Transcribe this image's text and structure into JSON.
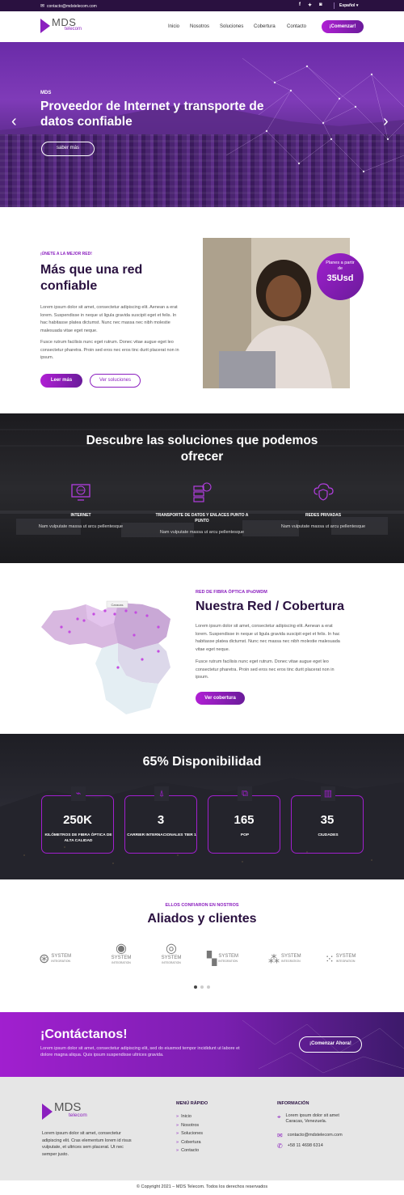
{
  "topbar": {
    "email": "contacto@mdstelecom.com",
    "social": [
      "f",
      "t",
      "ig"
    ],
    "language": "Español"
  },
  "header": {
    "logo_main": "MDS",
    "logo_sub": "telecom",
    "nav": [
      "Inicio",
      "Nosotros",
      "Soluciones",
      "Cobertura",
      "Contacto"
    ],
    "cta": "¡Comenzar!"
  },
  "hero": {
    "kicker": "MDS",
    "title": "Proveedor de Internet y transporte de datos confiable",
    "button": "saber más"
  },
  "intro": {
    "kicker": "¡ÚNETE A LA MEJOR RED!",
    "title": "Más que una red confiable",
    "p1": "Lorem ipsum dolor sit amet, consectetur adipiscing elit. Aenean a erat lorem. Suspendisse in neque ut ligula gravida suscipit eget et felis. In hac habitasse platea dictumst. Nunc nec massa nec nibh molestie malesuada vitae eget neque.",
    "p2": "Fusce rutrum facilisis nunc eget rutrum. Donec vitae augue eget leo consectetur pharetra. Proin sed eros nec eros tinc durit placerat non in ipsum.",
    "btn_primary": "Leer más",
    "btn_secondary": "Ver soluciones",
    "badge_top": "Planes a partir de",
    "badge_price": "35Usd"
  },
  "solutions": {
    "title": "Descubre las soluciones que podemos ofrecer",
    "items": [
      {
        "title": "INTERNET",
        "desc": "Nam vulputate massa ut arcu pellentesque"
      },
      {
        "title": "TRANSPORTE DE DATOS Y ENLACES PUNTO A PUNTO",
        "desc": "Nam vulputate massa ut arcu pellentesque"
      },
      {
        "title": "REDES PRIVADAS",
        "desc": "Nam vulputate massa ut arcu pellentesque"
      }
    ]
  },
  "coverage": {
    "map_label": "Caracas",
    "kicker": "RED DE FIBRA ÓPTICA IPoDWDM",
    "title": "Nuestra Red / Cobertura",
    "p1": "Lorem ipsum dolor sit amet, consectetur adipiscing elit. Aenean a erat lorem. Suspendisse in neque ut ligula gravida suscipit eget et felis. In hac habitasse platea dictumst. Nunc nec massa nec nibh molestie malesuada vitae eget neque.",
    "p2": "Fusce rutrum facilisis nunc eget rutrum. Donec vitae augue eget leo consectetur pharetra. Proin sed eros nec eros tinc durit placerat non in ipsum.",
    "button": "Ver cobertura"
  },
  "stats": {
    "title": "65% Disponibilidad",
    "items": [
      {
        "value": "250K",
        "label": "KILÓMETROS DE FIBRA ÓPTICA DE ALTA CALIDAD"
      },
      {
        "value": "3",
        "label": "CARRIER INTERNACIONALES TIER 1"
      },
      {
        "value": "165",
        "label": "POP"
      },
      {
        "value": "35",
        "label": "CIUDADES"
      }
    ]
  },
  "partners": {
    "kicker": "ELLOS CONFIARON EN NOSTROS",
    "title": "Aliados y clientes",
    "logo_main": "SYSTEM",
    "logo_sub": "INTEGRATION"
  },
  "contact_band": {
    "title": "¡Contáctanos!",
    "text": "Lorem ipsum dolor sit amet, consectetur adipiscing elit, sed do eiusmod tempor incididunt ut labore et dolore magna aliqua. Quis ipsum suspendisse ultrices gravida.",
    "button": "¡Comenzar Ahora!"
  },
  "footer": {
    "about": "Lorem ipsum dolor sit amet, consectetur adipiscing elit. Cras elementum lorem id risus vulputate, et ultrices sem placerat. Ut nec semper justo.",
    "menu_title": "MENÚ RÁPIDO",
    "menu": [
      "Inicio",
      "Nosotros",
      "Soluciones",
      "Cobertura",
      "Contacto"
    ],
    "info_title": "INFORMACIÓN",
    "address": "Lorem ipsum dolor sit amet Caracas, Venezuela.",
    "email": "contacto@mdstelecom.com",
    "phone": "+58 11 4698 6314",
    "copyright": "© Copyright 2021 – MDS Telecom. Todos los derechos reservados"
  },
  "colors": {
    "accent": "#8b1fbf",
    "dark": "#2a1140"
  }
}
